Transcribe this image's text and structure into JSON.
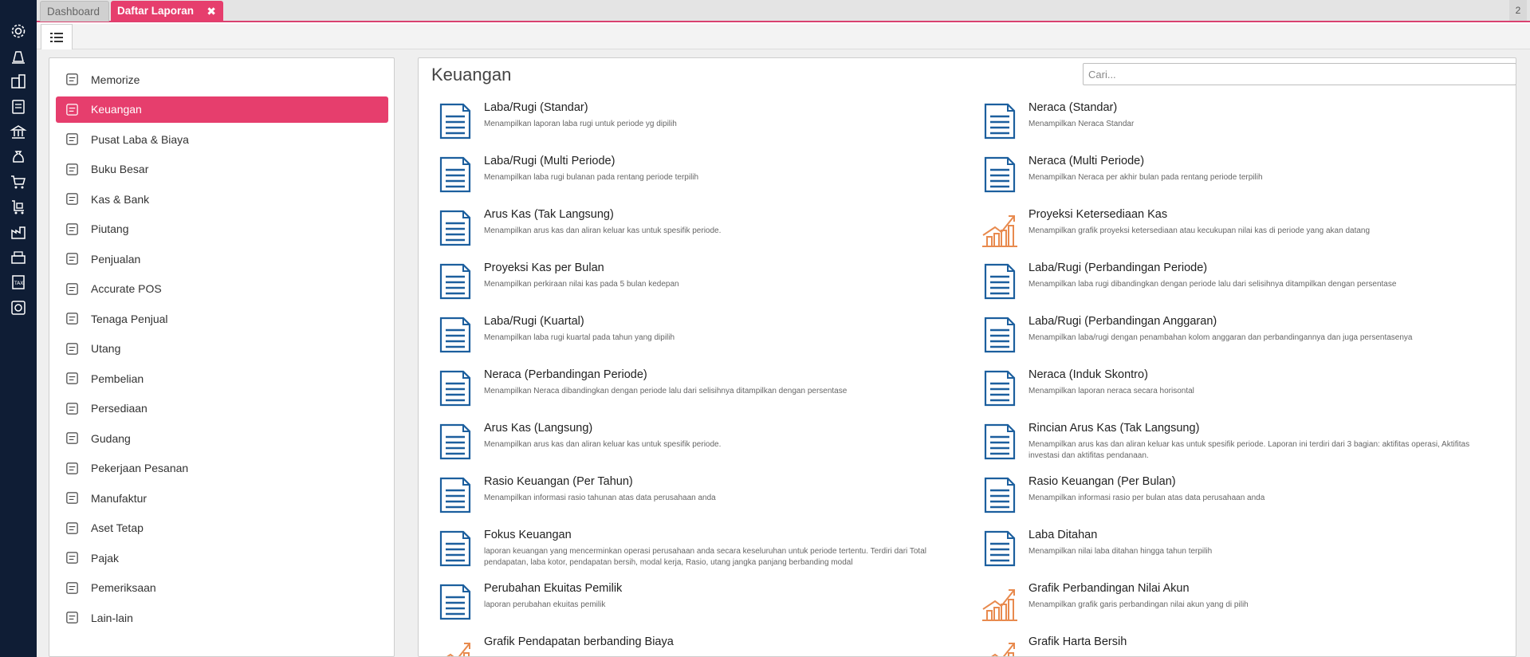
{
  "nav_icons": [
    "gear-icon",
    "pos-icon",
    "building-icon",
    "ledger-icon",
    "bank-icon",
    "money-bag-icon",
    "cart-icon",
    "purchase-cart-icon",
    "factory-icon",
    "cash-register-icon",
    "tax-icon",
    "report-icon"
  ],
  "tabs": {
    "dashboard": "Dashboard",
    "active": "Daftar Laporan",
    "close_symbol": "✖",
    "count": "2"
  },
  "sidebar": {
    "items": [
      {
        "label": "Memorize",
        "icon": "save-icon"
      },
      {
        "label": "Keuangan",
        "icon": "money-icon",
        "active": true
      },
      {
        "label": "Pusat Laba & Biaya",
        "icon": "org-chart-icon"
      },
      {
        "label": "Buku Besar",
        "icon": "book-icon"
      },
      {
        "label": "Kas & Bank",
        "icon": "wallet-icon"
      },
      {
        "label": "Piutang",
        "icon": "receivable-icon"
      },
      {
        "label": "Penjualan",
        "icon": "cart-icon"
      },
      {
        "label": "Accurate POS",
        "icon": "pos-icon"
      },
      {
        "label": "Tenaga Penjual",
        "icon": "salesperson-icon"
      },
      {
        "label": "Utang",
        "icon": "payable-icon"
      },
      {
        "label": "Pembelian",
        "icon": "purchase-icon"
      },
      {
        "label": "Persediaan",
        "icon": "inventory-icon"
      },
      {
        "label": "Gudang",
        "icon": "warehouse-icon"
      },
      {
        "label": "Pekerjaan Pesanan",
        "icon": "job-order-icon"
      },
      {
        "label": "Manufaktur",
        "icon": "manufacture-icon"
      },
      {
        "label": "Aset Tetap",
        "icon": "asset-icon"
      },
      {
        "label": "Pajak",
        "icon": "tax-icon"
      },
      {
        "label": "Pemeriksaan",
        "icon": "audit-icon"
      },
      {
        "label": "Lain-lain",
        "icon": "list-icon"
      }
    ]
  },
  "main": {
    "title": "Keuangan",
    "search_placeholder": "Cari...",
    "reports": [
      {
        "title": "Laba/Rugi (Standar)",
        "desc": "Menampilkan laporan laba rugi untuk periode yg dipilih",
        "icon": "document-icon"
      },
      {
        "title": "Neraca (Standar)",
        "desc": "Menampilkan Neraca Standar",
        "icon": "document-icon"
      },
      {
        "title": "Laba/Rugi (Multi Periode)",
        "desc": "Menampilkan laba rugi bulanan pada rentang periode terpilih",
        "icon": "document-icon"
      },
      {
        "title": "Neraca (Multi Periode)",
        "desc": "Menampilkan Neraca per akhir bulan pada rentang periode terpilih",
        "icon": "document-icon"
      },
      {
        "title": "Arus Kas (Tak Langsung)",
        "desc": "Menampilkan arus kas dan aliran keluar kas untuk spesifik periode.",
        "icon": "document-icon"
      },
      {
        "title": "Proyeksi Ketersediaan Kas",
        "desc": "Menampilkan grafik proyeksi ketersediaan atau kecukupan nilai kas di periode yang akan datang",
        "icon": "chart-icon"
      },
      {
        "title": "Proyeksi Kas per Bulan",
        "desc": "Menampilkan perkiraan nilai kas pada 5 bulan kedepan",
        "icon": "document-icon"
      },
      {
        "title": "Laba/Rugi (Perbandingan Periode)",
        "desc": "Menampilkan laba rugi dibandingkan dengan periode lalu dari selisihnya ditampilkan dengan persentase",
        "icon": "document-icon"
      },
      {
        "title": "Laba/Rugi (Kuartal)",
        "desc": "Menampilkan laba rugi kuartal pada tahun yang dipilih",
        "icon": "document-icon"
      },
      {
        "title": "Laba/Rugi (Perbandingan Anggaran)",
        "desc": "Menampilkan laba/rugi dengan penambahan kolom anggaran dan perbandingannya dan juga persentasenya",
        "icon": "document-icon"
      },
      {
        "title": "Neraca (Perbandingan Periode)",
        "desc": "Menampilkan Neraca dibandingkan dengan periode lalu dari selisihnya ditampilkan dengan persentase",
        "icon": "document-icon"
      },
      {
        "title": "Neraca (Induk Skontro)",
        "desc": "Menampilkan laporan neraca secara horisontal",
        "icon": "document-icon"
      },
      {
        "title": "Arus Kas (Langsung)",
        "desc": "Menampilkan arus kas dan aliran keluar kas untuk spesifik periode.",
        "icon": "document-icon"
      },
      {
        "title": "Rincian Arus Kas (Tak Langsung)",
        "desc": "Menampilkan arus kas dan aliran keluar kas untuk spesifik periode. Laporan ini terdiri dari 3 bagian: aktifitas operasi, Aktifitas investasi dan aktifitas pendanaan.",
        "icon": "document-icon"
      },
      {
        "title": "Rasio Keuangan (Per Tahun)",
        "desc": "Menampilkan informasi rasio tahunan atas data perusahaan anda",
        "icon": "document-icon"
      },
      {
        "title": "Rasio Keuangan (Per Bulan)",
        "desc": "Menampilkan informasi rasio per bulan atas data perusahaan anda",
        "icon": "document-icon"
      },
      {
        "title": "Fokus Keuangan",
        "desc": "laporan keuangan yang mencerminkan operasi perusahaan anda secara keseluruhan untuk periode tertentu. Terdiri dari Total pendapatan, laba kotor, pendapatan bersih, modal kerja, Rasio, utang jangka panjang berbanding modal",
        "icon": "document-icon"
      },
      {
        "title": "Laba Ditahan",
        "desc": "Menampilkan nilai laba ditahan hingga tahun terpilih",
        "icon": "document-icon"
      },
      {
        "title": "Perubahan Ekuitas Pemilik",
        "desc": "laporan perubahan ekuitas pemilik",
        "icon": "document-icon"
      },
      {
        "title": "Grafik Perbandingan Nilai Akun",
        "desc": "Menampilkan grafik garis perbandingan nilai akun yang di pilih",
        "icon": "chart-icon"
      },
      {
        "title": "Grafik Pendapatan berbanding Biaya",
        "desc": "",
        "icon": "chart-icon"
      },
      {
        "title": "Grafik Harta Bersih",
        "desc": "",
        "icon": "chart-icon"
      }
    ]
  },
  "colors": {
    "accent": "#e63e6d",
    "nav_bg": "#0f1d35",
    "doc_icon": "#1c5f9e",
    "chart_icon": "#e88a4e"
  }
}
